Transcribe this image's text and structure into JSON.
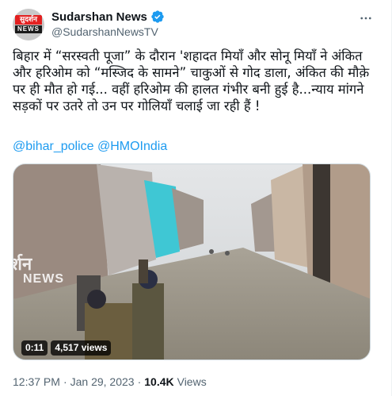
{
  "author": {
    "display_name": "Sudarshan News",
    "handle": "@SudarshanNewsTV",
    "avatar_top": "सुदर्शन",
    "avatar_bottom": "NEWS",
    "verified": true
  },
  "tweet": {
    "text": "बिहार में “सरस्वती पूजा” के दौरान 'शहादत मियाँ और सोनू मियाँ ने अंकित और हरिओम को “मस्जिद के सामने” चाकुओं से गोद डाला, अंकित की मौक़े पर ही मौत हो गई... वहीं हरिओम की हालत गंभीर बनी हुई है...न्याय मांगने सड़कों पर उतरे तो उन पर गोलियाँ चलाई जा रही हैं !",
    "mentions": [
      "@bihar_police",
      "@HMOIndia"
    ]
  },
  "media": {
    "type": "video",
    "overlay_watermark": "र्शन",
    "overlay_watermark_sub": "NEWS",
    "time": "0:11",
    "views": "4,517 views"
  },
  "meta": {
    "time": "12:37 PM",
    "separator": "·",
    "date": "Jan 29, 2023",
    "views_count": "10.4K",
    "views_label": "Views"
  },
  "colors": {
    "accent": "#1d9bf0",
    "text": "#0f1419",
    "secondary": "#536471"
  }
}
